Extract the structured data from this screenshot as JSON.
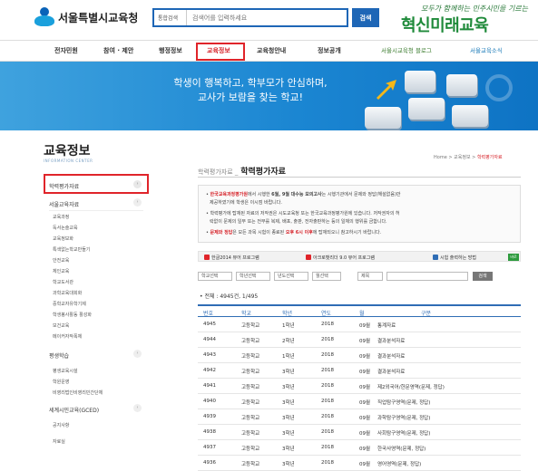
{
  "header": {
    "logo_text": "서울특별시교육청",
    "search_select": "통합검색",
    "search_placeholder": "검색어를 입력하세요",
    "search_button": "검색",
    "slogan_sub": "모두가 함께하는 민주시민을 기르는",
    "slogan_main": "혁신미래교육"
  },
  "nav": {
    "items": [
      "전자민원",
      "참여 · 제안",
      "행정정보",
      "교육정보",
      "교육청안내",
      "정보공개"
    ],
    "active_index": 3,
    "blog_label": "서울시교육청 블로그",
    "news_label": "서울교육소식"
  },
  "banner": {
    "line1": "학생이 행복하고, 학부모가 안심하며,",
    "line2": "교사가 보람을 찾는 학교!"
  },
  "sidebar": {
    "title": "교육정보",
    "subtitle": "INFORMATION CENTER",
    "selected_item": "학력평가자료",
    "category1": "서울교육자료",
    "sub_items": [
      "교육과정",
      "독서논술교육",
      "교육정보화",
      "특색없는학교만들기",
      "안전교육",
      "체인교육",
      "학교도서관",
      "과학교육대회화",
      "중학교자유학기제",
      "학생봉사활동 활성화",
      "보건교육",
      "메이커자작폭체"
    ],
    "category2": "평생학습",
    "sub_items2": [
      "평생교육시설",
      "학원운영",
      "비영리법인비영리민간단체"
    ],
    "category3": "세계시민교육(GCED)",
    "sub_items3": [
      "공지사항",
      "자료실"
    ]
  },
  "breadcrumb": {
    "home": "Home",
    "sep": ">",
    "level1": "교육정보",
    "level2": "학력평가자료"
  },
  "page": {
    "title_prefix": "학력평가자료 _",
    "title_main": "학력평가자료"
  },
  "info": {
    "line1a": "한국교육과정평가원",
    "line1b": "에서 시행한 ",
    "line1c": "6월, 9월 대수능 모의고사",
    "line1d": "는 시행기관에서 문제와 정답(해설없음)만",
    "line2": "제공하였기에 학생은 이시점 바랍니다.",
    "line3": "학력평가에 탑재된 자료의 저작권은 시도교육청 또는 한국교육과정평가원에 있습니다. 저작권자의 허",
    "line4": "락없이 문제의 일부 또는 전부를 복제, 배포, 출판, 전자출판하는 등의 일체의 행위를 금합니다.",
    "line5a": "문제와 정답",
    "line5b": "은 모든 과목 시험이 종료된 ",
    "line5c": "오후 6시 이후",
    "line5d": "에 탑재되오니 참고하시기 바랍니다."
  },
  "downloads": {
    "btn1": "한글2014 뷰어 프로그램",
    "btn2": "아크로뱃리더 9.0 뷰어 프로그램",
    "btn3": "시험 출력하는 방법",
    "go": "바로"
  },
  "filters": {
    "f1": "학교선택",
    "f2": "학년선택",
    "f3": "년도선택",
    "f4": "월선택",
    "f5": "제목",
    "search_button": "검색"
  },
  "count": {
    "label": "전체 : 4945건, 1/495"
  },
  "table": {
    "headers": [
      "번호",
      "학교",
      "학년",
      "연도",
      "월",
      "구분"
    ],
    "rows": [
      [
        "4945",
        "고등학교",
        "1학년",
        "2018",
        "09월",
        "통계자료"
      ],
      [
        "4944",
        "고등학교",
        "2학년",
        "2018",
        "09월",
        "결과분석자료"
      ],
      [
        "4943",
        "고등학교",
        "1학년",
        "2018",
        "09월",
        "결과분석자료"
      ],
      [
        "4942",
        "고등학교",
        "3학년",
        "2018",
        "09월",
        "결과분석자료"
      ],
      [
        "4941",
        "고등학교",
        "3학년",
        "2018",
        "09월",
        "제2외국어/한문영역(문제, 정답)"
      ],
      [
        "4940",
        "고등학교",
        "3학년",
        "2018",
        "09월",
        "직업탐구영역(문제, 정답)"
      ],
      [
        "4939",
        "고등학교",
        "3학년",
        "2018",
        "09월",
        "과학탐구영역(문제, 정답)"
      ],
      [
        "4938",
        "고등학교",
        "3학년",
        "2018",
        "09월",
        "사회탐구영역(문제, 정답)"
      ],
      [
        "4937",
        "고등학교",
        "3학년",
        "2018",
        "09월",
        "한국사영역(문제, 정답)"
      ],
      [
        "4936",
        "고등학교",
        "3학년",
        "2018",
        "09월",
        "영어영역(문제, 정답)"
      ]
    ]
  }
}
